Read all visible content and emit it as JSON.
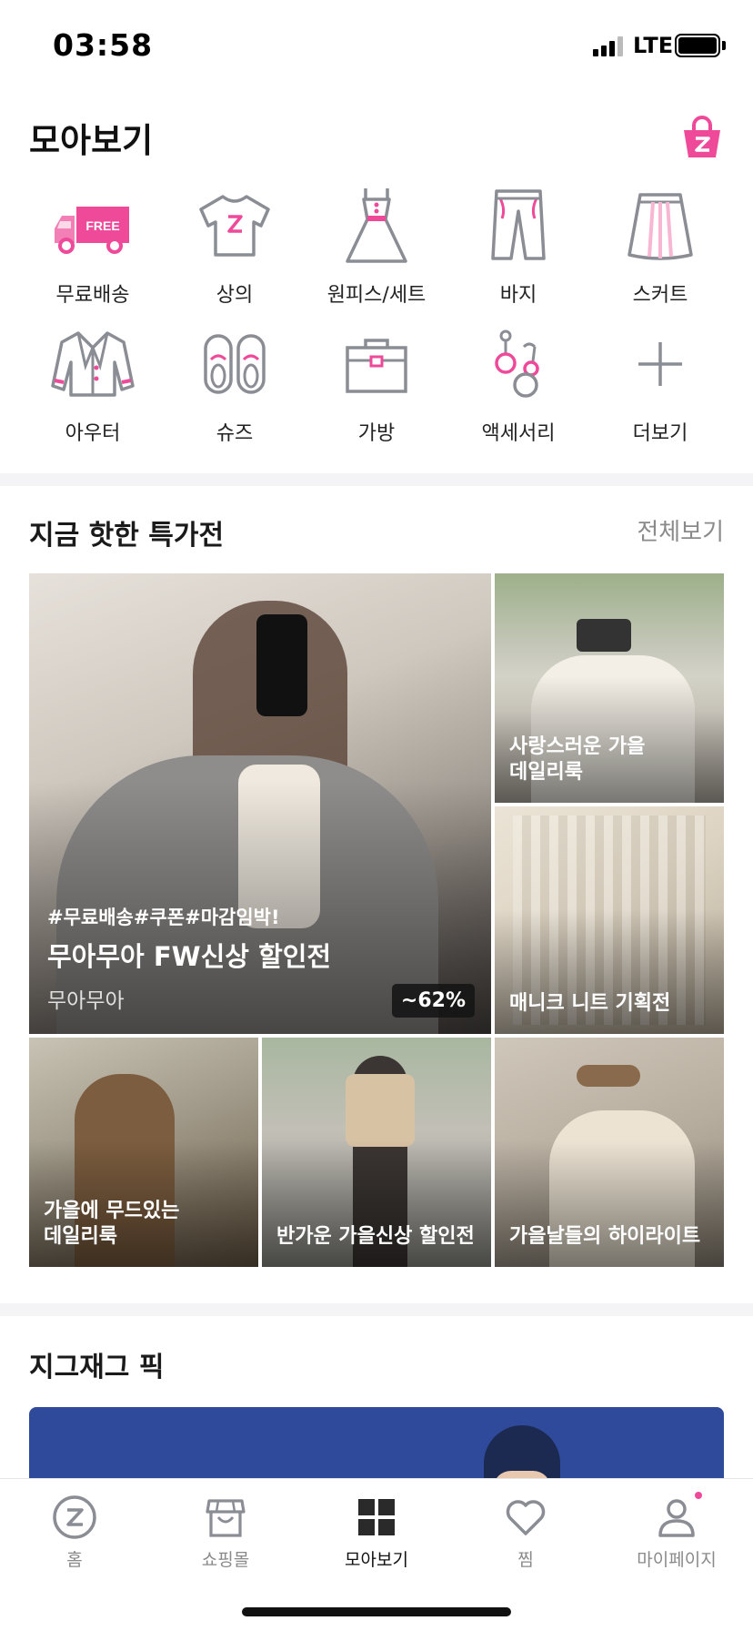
{
  "status_bar": {
    "time": "03:58",
    "network": "LTE"
  },
  "header": {
    "title": "모아보기"
  },
  "categories": [
    {
      "label": "무료배송",
      "icon": "free-shipping-truck-icon",
      "badge": "FREE"
    },
    {
      "label": "상의",
      "icon": "tshirt-icon"
    },
    {
      "label": "원피스/세트",
      "icon": "dress-icon"
    },
    {
      "label": "바지",
      "icon": "pants-icon"
    },
    {
      "label": "스커트",
      "icon": "skirt-icon"
    },
    {
      "label": "아우터",
      "icon": "jacket-icon"
    },
    {
      "label": "슈즈",
      "icon": "shoes-icon"
    },
    {
      "label": "가방",
      "icon": "bag-icon"
    },
    {
      "label": "액세서리",
      "icon": "earrings-icon"
    },
    {
      "label": "더보기",
      "icon": "plus-icon"
    }
  ],
  "hot_deals": {
    "title": "지금 핫한 특가전",
    "view_all": "전체보기",
    "main": {
      "tags": "#무료배송#쿠폰#마감임박!",
      "title": "무아무아 FW신상 할인전",
      "store": "무아무아",
      "discount": "~62%"
    },
    "tiles": [
      {
        "caption": "사랑스러운 가을\n데일리룩"
      },
      {
        "caption": "매니크 니트 기획전"
      },
      {
        "caption": "가을에 무드있는\n데일리룩"
      },
      {
        "caption": "반가운 가을신상 할인전"
      },
      {
        "caption": "가을날들의 하이라이트"
      }
    ]
  },
  "picks": {
    "title": "지그재그 픽"
  },
  "tab_bar": {
    "tabs": [
      {
        "label": "홈",
        "icon": "zigzag-home-icon"
      },
      {
        "label": "쇼핑몰",
        "icon": "store-icon"
      },
      {
        "label": "모아보기",
        "icon": "grid-icon",
        "active": true
      },
      {
        "label": "찜",
        "icon": "heart-icon"
      },
      {
        "label": "마이페이지",
        "icon": "person-icon"
      }
    ]
  },
  "colors": {
    "accent": "#ee4a99",
    "icon_gray": "#8a8d94",
    "pink_light": "#f7b6d2",
    "banner_blue": "#2f4a9a"
  }
}
